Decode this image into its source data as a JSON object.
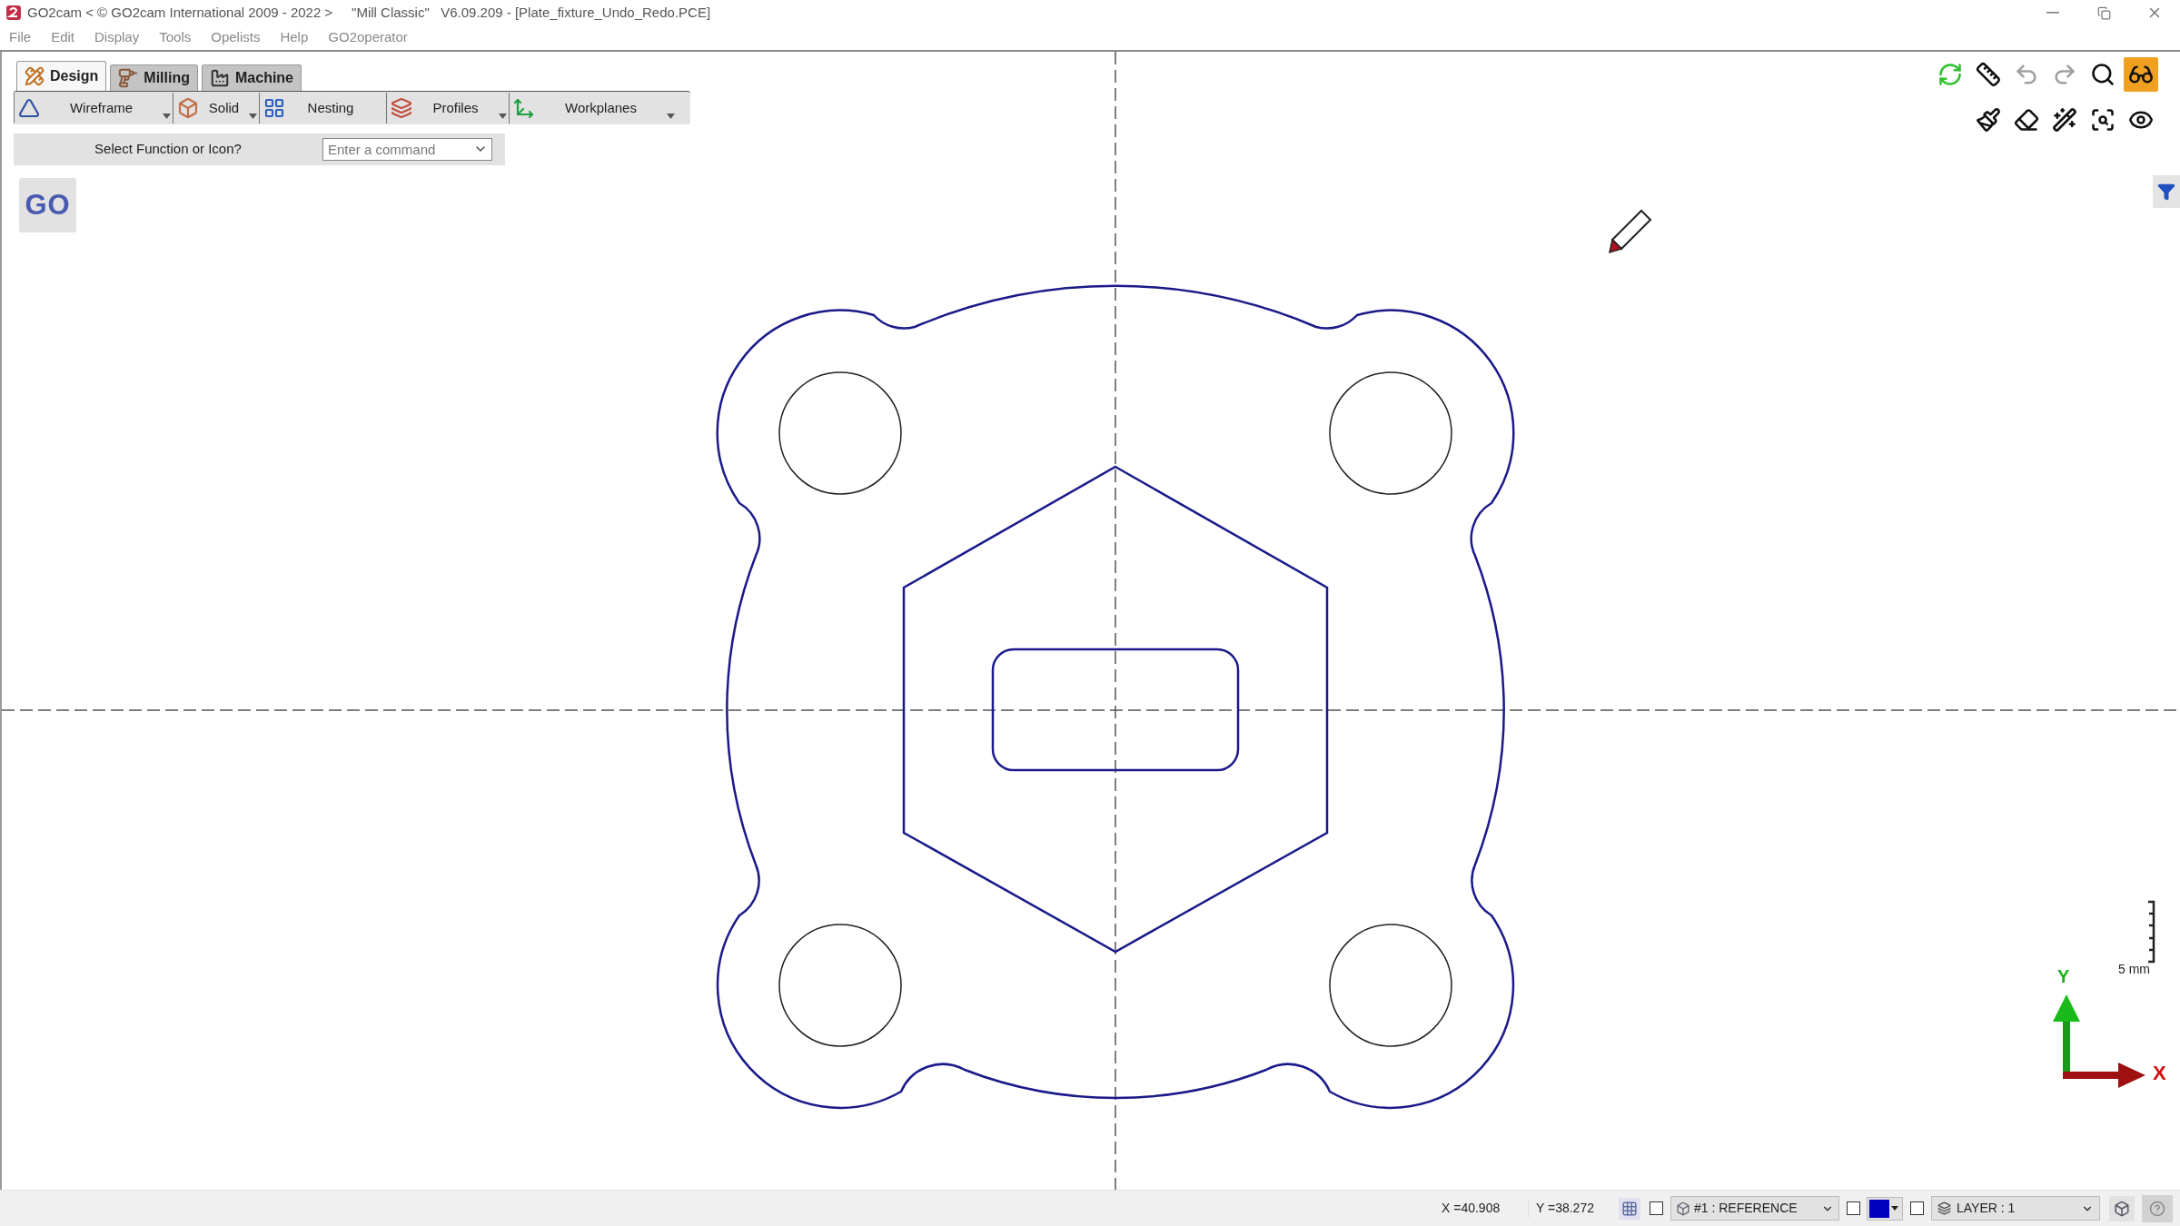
{
  "window": {
    "title": "GO2cam < © GO2cam International 2009 - 2022 >     \"Mill Classic\"   V6.09.209 - [Plate_fixture_Undo_Redo.PCE]"
  },
  "menu": [
    "File",
    "Edit",
    "Display",
    "Tools",
    "Opelists",
    "Help",
    "GO2operator"
  ],
  "tabs": [
    {
      "label": "Design",
      "kind": "design",
      "selected": true
    },
    {
      "label": "Milling",
      "kind": "milling",
      "selected": false
    },
    {
      "label": "Machine",
      "kind": "machine",
      "selected": false
    }
  ],
  "toolbar": [
    {
      "label": "Wireframe",
      "kind": "wireframe",
      "dropdown": true
    },
    {
      "label": "Solid",
      "kind": "solid",
      "dropdown": true
    },
    {
      "label": "Nesting",
      "kind": "nesting",
      "dropdown": false
    },
    {
      "label": "Profiles",
      "kind": "profiles",
      "dropdown": true
    },
    {
      "label": "Workplanes",
      "kind": "workplanes",
      "dropdown": true
    }
  ],
  "command": {
    "prompt": "Select Function or Icon?",
    "placeholder": "Enter a command"
  },
  "go_button": "GO",
  "view_toolbar": [
    {
      "kind": "refresh",
      "disabled": false,
      "selected": false
    },
    {
      "kind": "measure",
      "disabled": false,
      "selected": false
    },
    {
      "kind": "undo",
      "disabled": true,
      "selected": false
    },
    {
      "kind": "redo",
      "disabled": true,
      "selected": false
    },
    {
      "kind": "zoom",
      "disabled": false,
      "selected": false
    },
    {
      "kind": "glasses",
      "disabled": false,
      "selected": true
    }
  ],
  "view_toolbar_2": [
    {
      "kind": "palette"
    },
    {
      "kind": "eraser"
    },
    {
      "kind": "magic"
    },
    {
      "kind": "zoom-fit"
    },
    {
      "kind": "eye"
    }
  ],
  "scale": {
    "label": "5 mm"
  },
  "axes": {
    "x": "X",
    "y": "Y"
  },
  "status_bar": {
    "x": "X =40.908",
    "y": "Y =38.272",
    "toggles": [
      {
        "checked": false
      },
      {
        "checked": false
      },
      {
        "checked": false
      }
    ],
    "plane": "#1 : REFERENCE",
    "color": "#0000c0",
    "layer": "LAYER : 1"
  }
}
